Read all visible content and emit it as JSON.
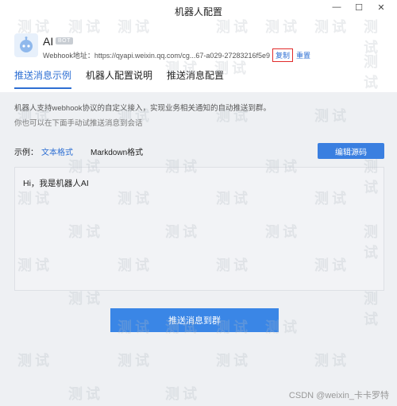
{
  "window": {
    "title": "机器人配置",
    "minimize": "—",
    "maximize": "☐",
    "close": "✕"
  },
  "bot": {
    "name": "AI",
    "badge": "BOT",
    "webhook_label": "Webhook地址：",
    "webhook_url": "https://qyapi.weixin.qq.com/cg...67-a029-27283216f5e9",
    "copy_label": "复制",
    "reset_label": "重置"
  },
  "tabs": [
    {
      "label": "推送消息示例",
      "active": true
    },
    {
      "label": "机器人配置说明",
      "active": false
    },
    {
      "label": "推送消息配置",
      "active": false
    }
  ],
  "content": {
    "desc_line1": "机器人支持webhook协议的自定义接入，实现业务相关通知的自动推送到群。",
    "desc_line2": "你也可以在下面手动试推送消息到会话",
    "example_label": "示例：",
    "format_text": "文本格式",
    "format_markdown": "Markdown格式",
    "edit_source": "编辑源码",
    "message": "Hi，我是机器人AI",
    "push_button": "推送消息到群"
  },
  "watermark": "测试",
  "credit": "CSDN @weixin_卡卡罗特",
  "colors": {
    "accent": "#2e6fd3",
    "button": "#3a86e6",
    "highlight_border": "#e12b2b"
  }
}
